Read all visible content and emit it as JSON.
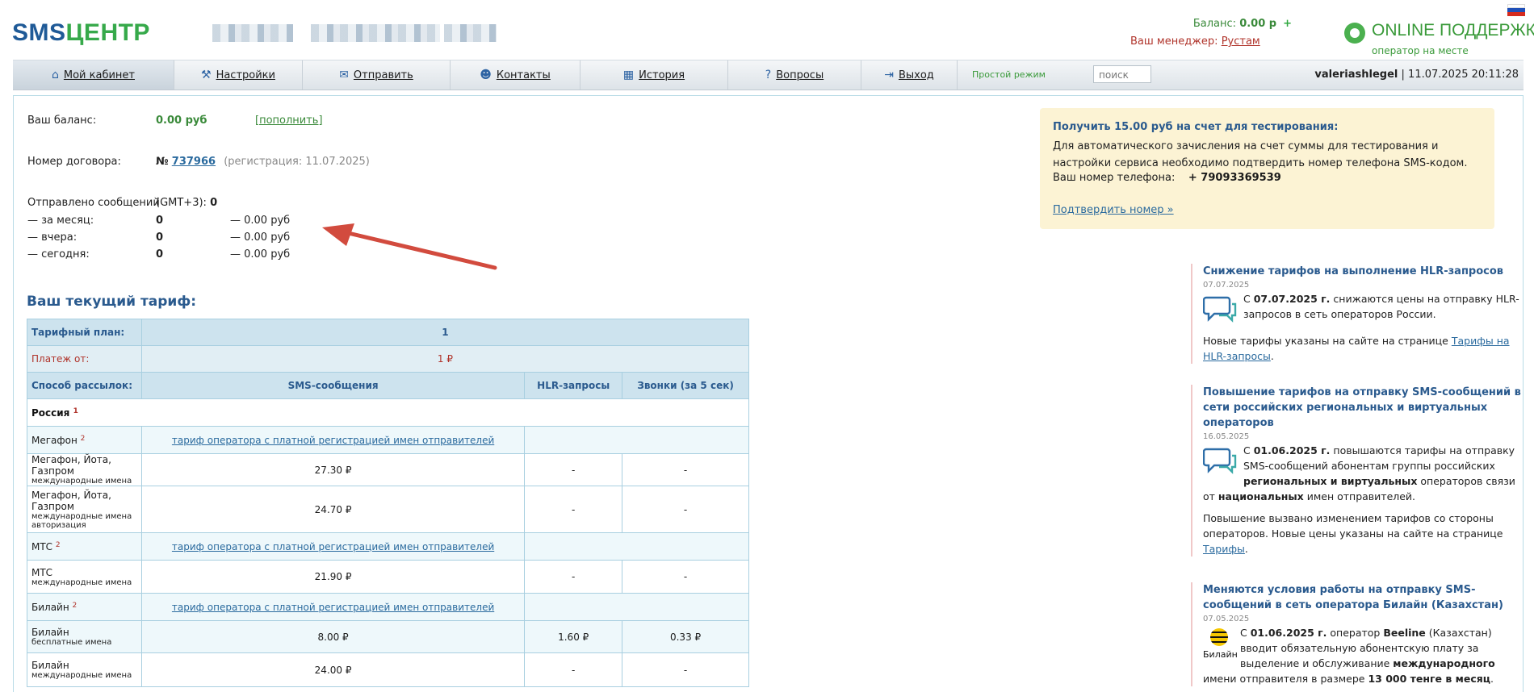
{
  "header": {
    "logo_sms": "SMS",
    "logo_centr": "ЦЕНТР",
    "balance_label": "Баланс:",
    "balance_value": "0.00 р",
    "balance_plus": "+",
    "manager_label": "Ваш менеджер:",
    "manager_name": "Рустам",
    "support_title": "ONLINE ПОДДЕРЖКА",
    "support_sub": "оператор на месте"
  },
  "nav": {
    "items": [
      {
        "label": "Мой кабинет",
        "icon": "home-icon"
      },
      {
        "label": "Настройки",
        "icon": "tools-icon"
      },
      {
        "label": "Отправить",
        "icon": "envelope-icon"
      },
      {
        "label": "Контакты",
        "icon": "contacts-icon"
      },
      {
        "label": "История",
        "icon": "calendar-icon"
      },
      {
        "label": "Вопросы",
        "icon": "question-icon"
      },
      {
        "label": "Выход",
        "icon": "exit-icon"
      }
    ],
    "simple_mode": "Простой режим",
    "search_placeholder": "поиск",
    "username": "valeriashlegel",
    "datetime": "11.07.2025 20:11:28"
  },
  "account": {
    "balance_label": "Ваш баланс:",
    "balance_value": "0.00 руб",
    "topup_link": "[пополнить]",
    "contract_label": "Номер договора:",
    "contract_prefix": "№",
    "contract_number": "737966",
    "registration": "(регистрация: 11.07.2025)",
    "sent_label": "Отправлено сообщений",
    "sent_tz": "(GMT+3):",
    "sent_total": "0",
    "rows": [
      {
        "label": "— за месяц:",
        "count": "0",
        "sum": "— 0.00 руб"
      },
      {
        "label": "— вчера:",
        "count": "0",
        "sum": "— 0.00 руб"
      },
      {
        "label": "— сегодня:",
        "count": "0",
        "sum": "— 0.00 руб"
      }
    ]
  },
  "promo": {
    "title": "Получить 15.00 руб на счет для тестирования:",
    "description": "Для автоматического зачисления на счет суммы для тестирования и настройки сервиса необходимо подтвердить номер телефона SMS-кодом.",
    "phone_label": "Ваш номер телефона:",
    "phone_value": "+ 79093369539",
    "confirm_link": "Подтвердить номер »"
  },
  "tariff": {
    "title": "Ваш текущий тариф:",
    "plan_label": "Тарифный план:",
    "plan_value": "1",
    "payment_label": "Платеж от:",
    "payment_value": "1 ₽",
    "method_label": "Способ рассылок:",
    "col_sms": "SMS-сообщения",
    "col_hlr": "HLR-запросы",
    "col_calls": "Звонки (за 5 сек)",
    "country": "Россия",
    "country_sup": "1",
    "operator_note": "тариф оператора с платной регистрацией имен отправителей",
    "megafon": "Мегафон",
    "megafon_sup": "2",
    "megafon_rates": [
      {
        "name": "Мегафон, Йота, Газпром",
        "sub": "международные имена",
        "sms": "27.30 ₽",
        "hlr": "-",
        "calls": "-"
      },
      {
        "name": "Мегафон, Йота, Газпром",
        "sub": "международные имена авторизация",
        "sms": "24.70 ₽",
        "hlr": "-",
        "calls": "-"
      }
    ],
    "mts": "МТС",
    "mts_sup": "2",
    "mts_rates": [
      {
        "name": "МТС",
        "sub": "международные имена",
        "sms": "21.90 ₽",
        "hlr": "-",
        "calls": "-"
      }
    ],
    "beeline": "Билайн",
    "beeline_sup": "2",
    "beeline_rates": [
      {
        "name": "Билайн",
        "sub": "бесплатные имена",
        "sms": "8.00 ₽",
        "hlr": "1.60 ₽",
        "calls": "0.33 ₽"
      },
      {
        "name": "Билайн",
        "sub": "международные имена",
        "sms": "24.00 ₽",
        "hlr": "-",
        "calls": "-"
      }
    ]
  },
  "news": [
    {
      "title": "Снижение тарифов на выполнение HLR-запросов",
      "date": "07.07.2025",
      "p1_pre": "С ",
      "p1_bold": "07.07.2025 г.",
      "p1_post": " снижаются цены на отправку HLR-запросов в сеть операторов России.",
      "p2_pre": "Новые тарифы указаны на сайте на странице ",
      "p2_link": "Тарифы на HLR-запросы",
      "p2_post": "."
    },
    {
      "title": "Повышение тарифов на отправку SMS-сообщений в сети российских региональных и виртуальных операторов",
      "date": "16.05.2025",
      "p1_pre": "С ",
      "p1_bold": "01.06.2025 г.",
      "p1_mid": " повышаются тарифы на отправку SMS-сообщений абонентам группы российских ",
      "p1_bold2": "региональных и виртуальных",
      "p1_mid2": " операторов связи от ",
      "p1_bold3": "национальных",
      "p1_post": " имен отправителей.",
      "p2_pre": "Повышение вызвано изменением тарифов со стороны операторов. Новые цены указаны на сайте на странице ",
      "p2_link": "Тарифы",
      "p2_post": "."
    },
    {
      "title": "Меняются условия работы на отправку SMS-сообщений в сеть оператора Билайн (Казахстан)",
      "date": "07.05.2025",
      "p1_pre": "С ",
      "p1_bold": "01.06.2025 г.",
      "p1_mid": " оператор ",
      "p1_bold2": "Beeline",
      "p1_mid2": " (Казахстан) вводит обязательную абонентскую плату за выделение и обслуживание ",
      "p1_bold3": "международного",
      "p1_mid3": " имени отправителя в размере ",
      "p1_bold4": "13 000 тенге в месяц",
      "p1_post": ".",
      "logo_label": "Билайн"
    }
  ]
}
